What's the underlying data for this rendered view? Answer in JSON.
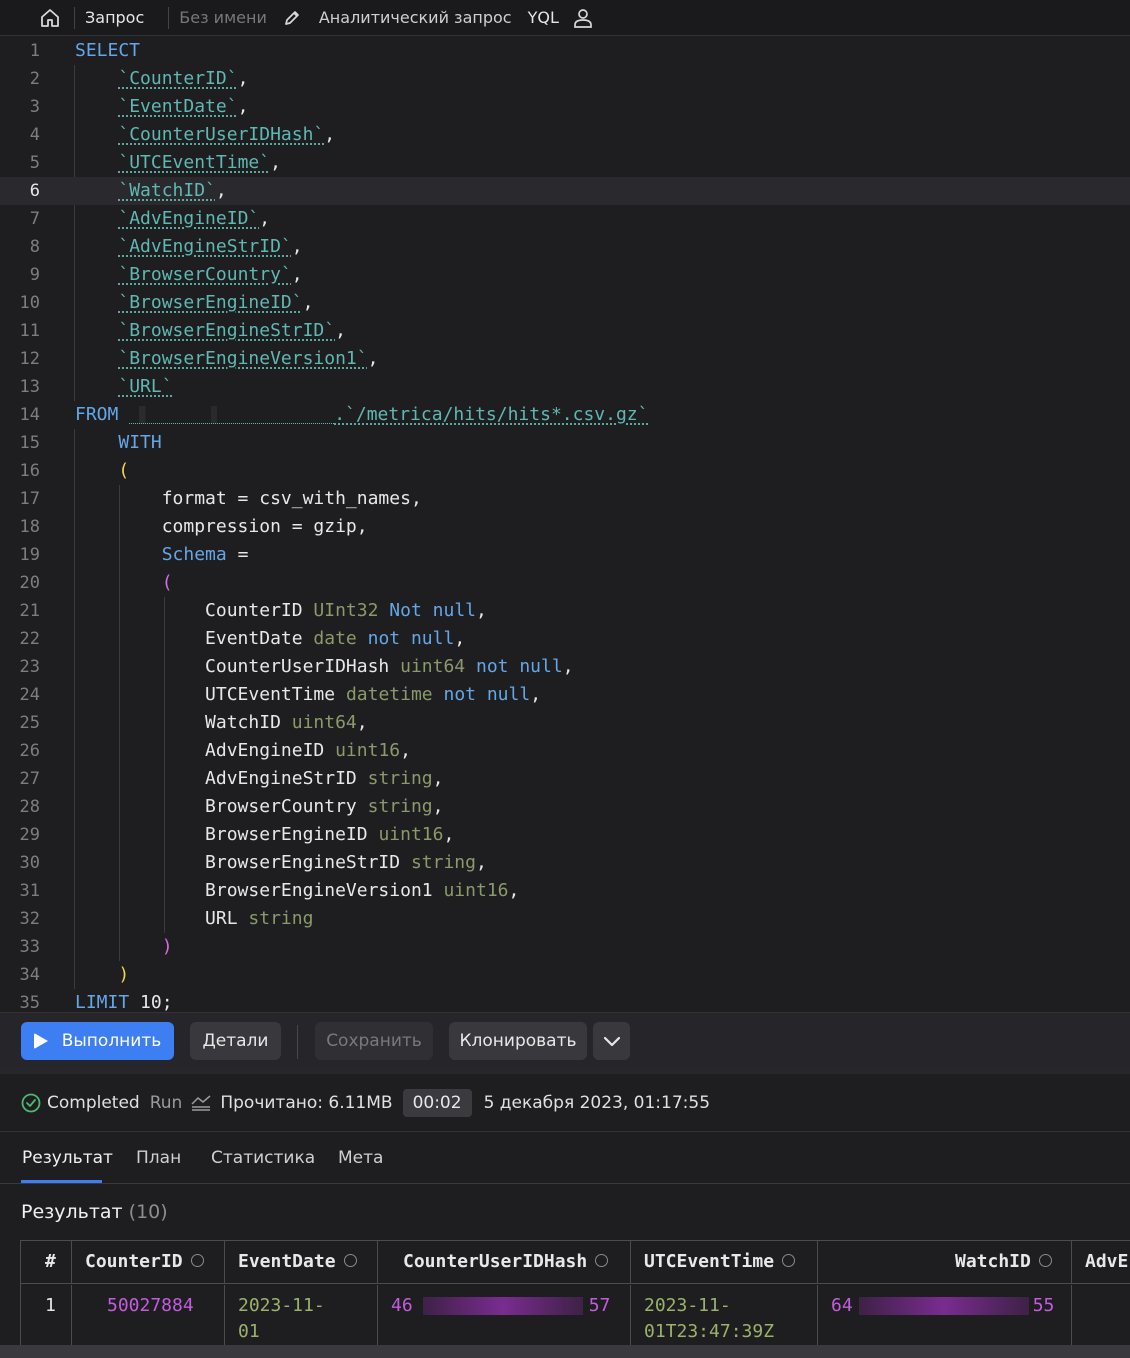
{
  "topbar": {
    "tab_label": "Запрос",
    "query_name": "Без имени",
    "query_type": "Аналитический запрос",
    "syntax": "YQL"
  },
  "editor": {
    "line_numbers": [
      "1",
      "2",
      "3",
      "4",
      "5",
      "6",
      "7",
      "8",
      "9",
      "10",
      "11",
      "12",
      "13",
      "14",
      "15",
      "16",
      "17",
      "18",
      "19",
      "20",
      "21",
      "22",
      "23",
      "24",
      "25",
      "26",
      "27",
      "28",
      "29",
      "30",
      "31",
      "32",
      "33",
      "34",
      "35"
    ],
    "active_line": "6",
    "tokens": {
      "select": "SELECT",
      "from": "FROM",
      "with": "WITH",
      "limit": "LIMIT",
      "limit_value": "10",
      "schema": "Schema",
      "path": "`/metrica/hits/hits*.csv.gz`",
      "format_line": "format = csv_with_names,",
      "compression_line": "compression = gzip,"
    },
    "select_columns": [
      "`CounterID`",
      "`EventDate`",
      "`CounterUserIDHash`",
      "`UTCEventTime`",
      "`WatchID`",
      "`AdvEngineID`",
      "`AdvEngineStrID`",
      "`BrowserCountry`",
      "`BrowserEngineID`",
      "`BrowserEngineStrID`",
      "`BrowserEngineVersion1`",
      "`URL`"
    ],
    "schema_fields": [
      {
        "name": "CounterID",
        "type": "UInt32",
        "mod": "Not null"
      },
      {
        "name": "EventDate",
        "type": "date",
        "mod": "not null"
      },
      {
        "name": "CounterUserIDHash",
        "type": "uint64",
        "mod": "not null"
      },
      {
        "name": "UTCEventTime",
        "type": "datetime",
        "mod": "not null"
      },
      {
        "name": "WatchID",
        "type": "uint64",
        "mod": ""
      },
      {
        "name": "AdvEngineID",
        "type": "uint16",
        "mod": ""
      },
      {
        "name": "AdvEngineStrID",
        "type": "string",
        "mod": ""
      },
      {
        "name": "BrowserCountry",
        "type": "string",
        "mod": ""
      },
      {
        "name": "BrowserEngineID",
        "type": "uint16",
        "mod": ""
      },
      {
        "name": "BrowserEngineStrID",
        "type": "string",
        "mod": ""
      },
      {
        "name": "BrowserEngineVersion1",
        "type": "uint16",
        "mod": ""
      },
      {
        "name": "URL",
        "type": "string",
        "mod": ""
      }
    ]
  },
  "toolbar": {
    "run_label": "Выполнить",
    "details_label": "Детали",
    "save_label": "Сохранить",
    "clone_label": "Клонировать",
    "run_color": "#3d7ef2"
  },
  "status": {
    "state": "Completed",
    "mode": "Run",
    "read": "Прочитано: 6.11MB",
    "elapsed": "00:02",
    "datetime": "5 декабря 2023, 01:17:55"
  },
  "tabs": [
    "Результат",
    "План",
    "Статистика",
    "Мета"
  ],
  "result": {
    "title": "Результат",
    "count": "(10)",
    "columns": [
      "#",
      "CounterID",
      "EventDate",
      "CounterUserIDHash",
      "UTCEventTime",
      "WatchID",
      "AdvE"
    ],
    "row1": {
      "index": "1",
      "counter_id": "50027884",
      "event_date_1": "2023-11-",
      "event_date_2": "01",
      "hash_start": "46",
      "hash_end": "57",
      "utc_1": "2023-11-",
      "utc_2": "01T23:47:39Z",
      "watch_start": "64",
      "watch_end": "55"
    }
  }
}
